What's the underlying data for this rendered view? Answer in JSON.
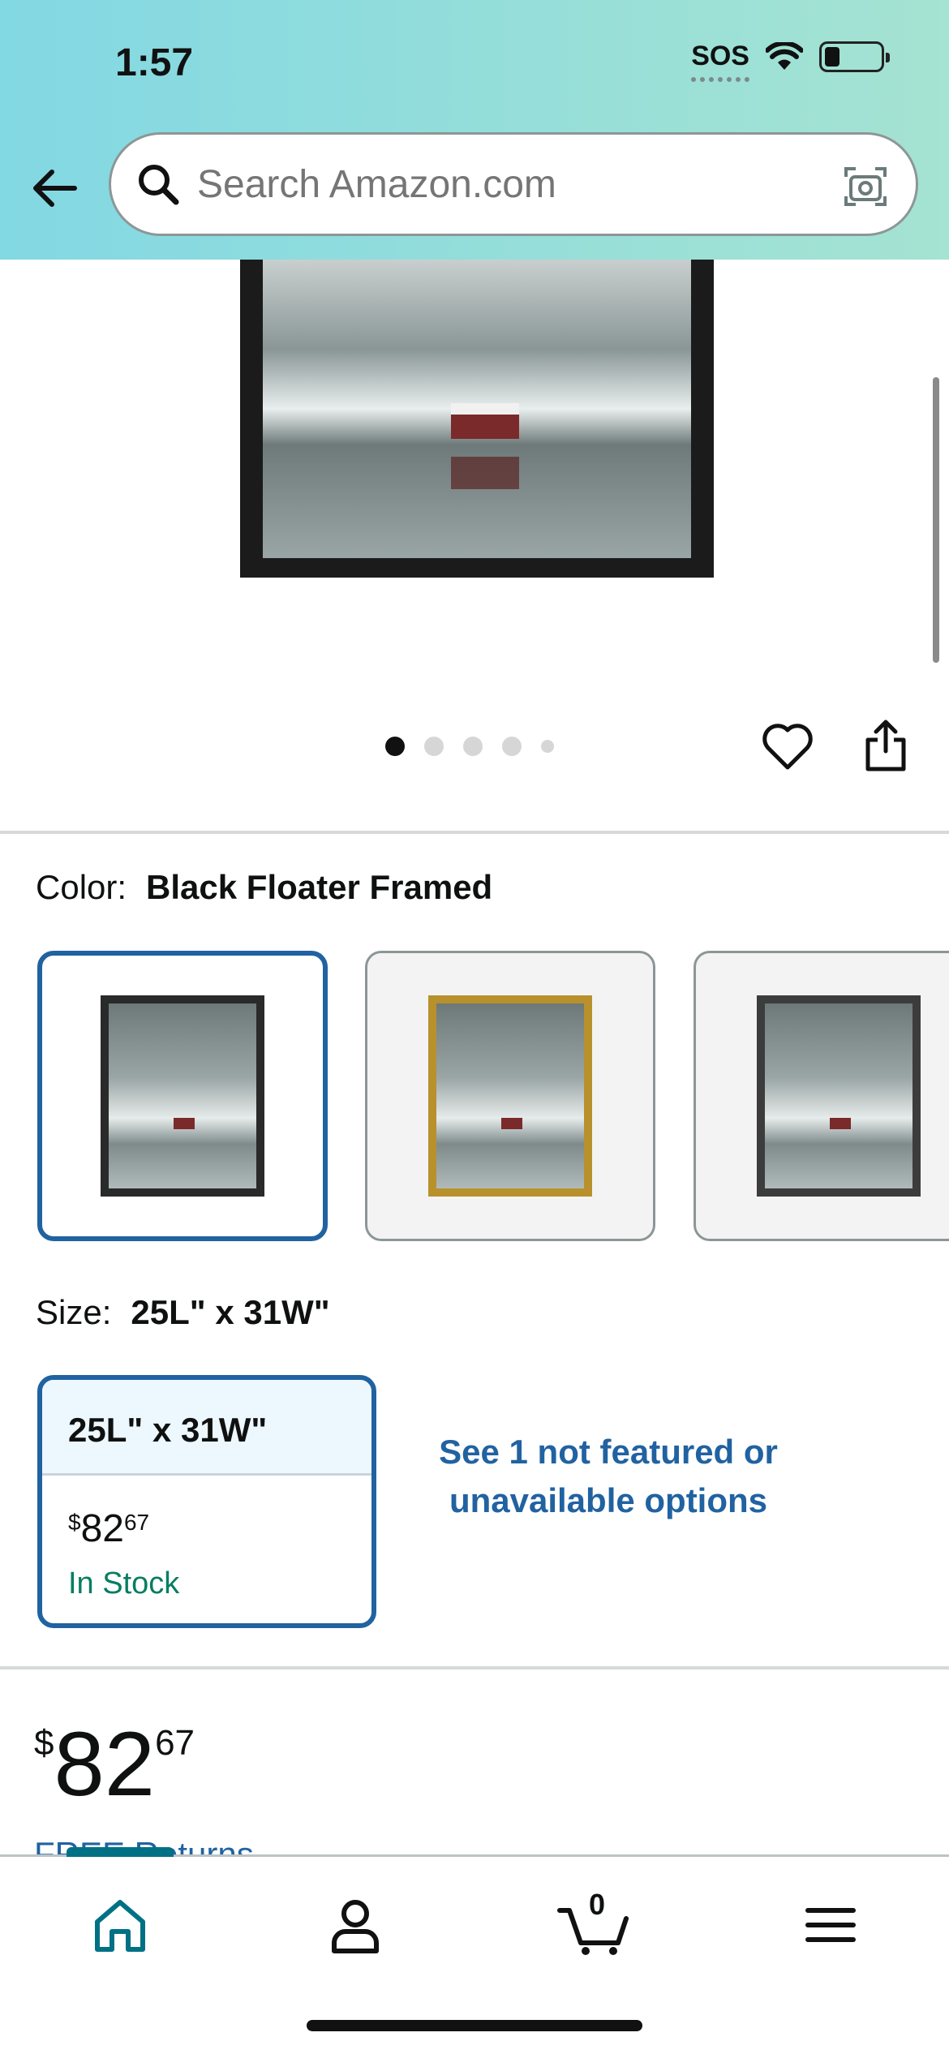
{
  "status_bar": {
    "time": "1:57",
    "sos": "SOS"
  },
  "search": {
    "placeholder": "Search Amazon.com"
  },
  "carousel": {
    "dot_count": 5,
    "active_index": 0
  },
  "color": {
    "label": "Color:",
    "selected": "Black Floater Framed",
    "swatches": [
      {
        "frame_color": "#2a2a2a",
        "selected": true
      },
      {
        "frame_color": "#b8912c",
        "selected": false
      },
      {
        "frame_color": "#3c3c3c",
        "selected": false
      }
    ]
  },
  "size": {
    "label": "Size:",
    "selected": "25L\" x 31W\"",
    "card": {
      "title": "25L\" x 31W\"",
      "price_symbol": "$",
      "price_whole": "82",
      "price_cents": "67",
      "stock": "In Stock"
    },
    "more_options": "See 1 not featured or unavailable options"
  },
  "price": {
    "symbol": "$",
    "whole": "82",
    "cents": "67"
  },
  "free_returns": "FREE Returns",
  "nav": {
    "cart_count": "0",
    "active": "home"
  },
  "colors": {
    "accent": "#2162a1",
    "stock_green": "#067d62",
    "nav_active": "#007185"
  }
}
